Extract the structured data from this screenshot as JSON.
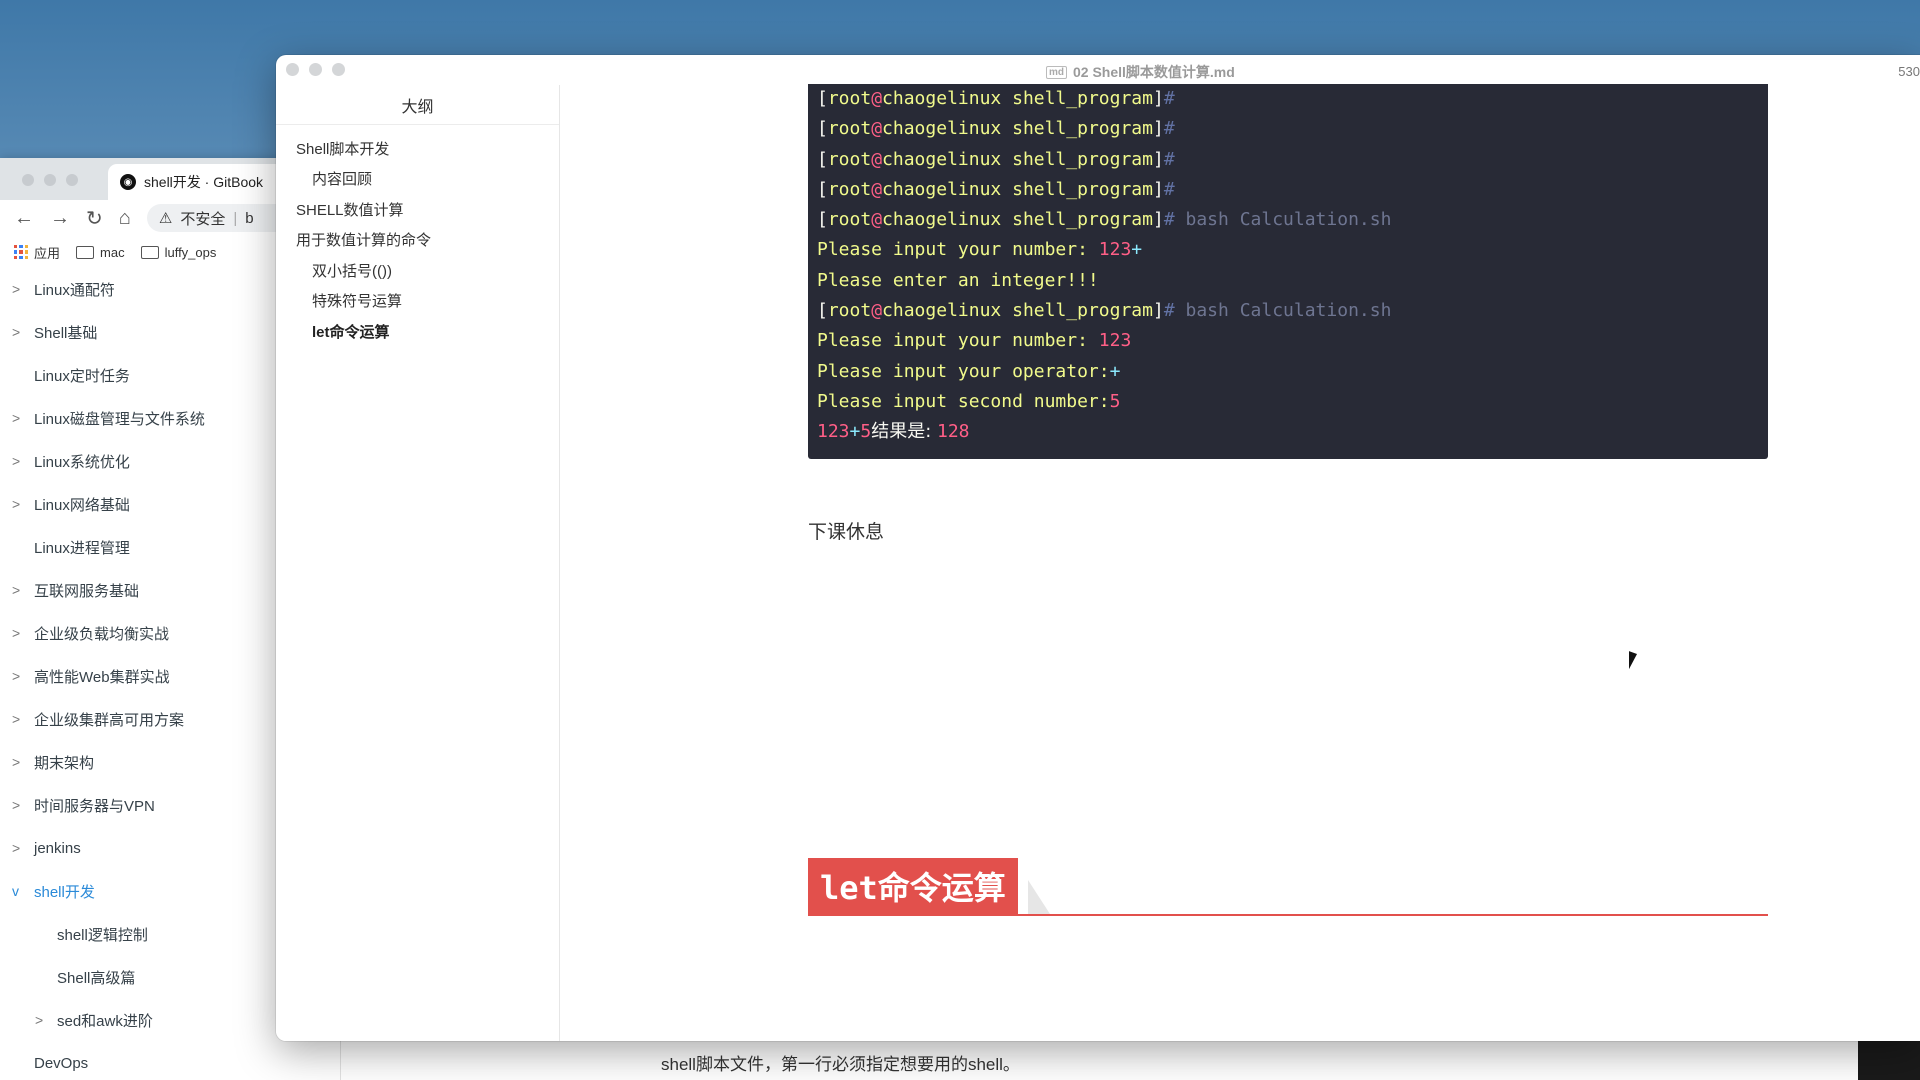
{
  "browser": {
    "tab_title": "shell开发 · GitBook",
    "url_security": "不安全",
    "url_fragment": "b",
    "bookmarks": [
      "应用",
      "mac",
      "luffy_ops"
    ]
  },
  "gitbook_nav": {
    "items": [
      {
        "label": "Linux通配符",
        "chevron": ">"
      },
      {
        "label": "Shell基础",
        "chevron": ">"
      },
      {
        "label": "Linux定时任务",
        "chevron": ""
      },
      {
        "label": "Linux磁盘管理与文件系统",
        "chevron": ">"
      },
      {
        "label": "Linux系统优化",
        "chevron": ">"
      },
      {
        "label": "Linux网络基础",
        "chevron": ">"
      },
      {
        "label": "Linux进程管理",
        "chevron": ""
      },
      {
        "label": "互联网服务基础",
        "chevron": ">"
      },
      {
        "label": "企业级负载均衡实战",
        "chevron": ">"
      },
      {
        "label": "高性能Web集群实战",
        "chevron": ">"
      },
      {
        "label": "企业级集群高可用方案",
        "chevron": ">"
      },
      {
        "label": "期末架构",
        "chevron": ">"
      },
      {
        "label": "时间服务器与VPN",
        "chevron": ">"
      },
      {
        "label": "jenkins",
        "chevron": ">"
      },
      {
        "label": "shell开发",
        "chevron": "v"
      },
      {
        "label": "shell逻辑控制",
        "chevron": ""
      },
      {
        "label": "Shell高级篇",
        "chevron": ""
      },
      {
        "label": "sed和awk进阶",
        "chevron": ">"
      },
      {
        "label": "DevOps",
        "chevron": ""
      }
    ]
  },
  "bottom_text": "shell脚本文件，第一行必须指定想要用的shell。",
  "typora": {
    "doc_title": "02 Shell脚本数值计算.md",
    "counter": "530",
    "outline_title": "大纲",
    "outline": [
      {
        "label": "Shell脚本开发"
      },
      {
        "label": "内容回顾"
      },
      {
        "label": "SHELL数值计算"
      },
      {
        "label": "用于数值计算的命令"
      },
      {
        "label": "双小括号(())"
      },
      {
        "label": "特殊符号运算"
      },
      {
        "label": "let命令运算"
      }
    ]
  },
  "terminal": {
    "open": "[",
    "user": "root",
    "at": "@",
    "host": "chaogelinux",
    "dir": " shell_program",
    "close": "]",
    "hash": "#",
    "cmd": " bash Calculation.sh",
    "prompt_number": "Please input your number: ",
    "input1": "123",
    "plus": "+",
    "enter_integer": "Please enter an integer!!!",
    "prompt_operator": "Please input your operator:",
    "prompt_second": "Please input second number:",
    "input2": "5",
    "result_label": "结果是: ",
    "result": "128"
  },
  "content": {
    "paragraph": "下课休息",
    "heading": "let命令运算"
  }
}
